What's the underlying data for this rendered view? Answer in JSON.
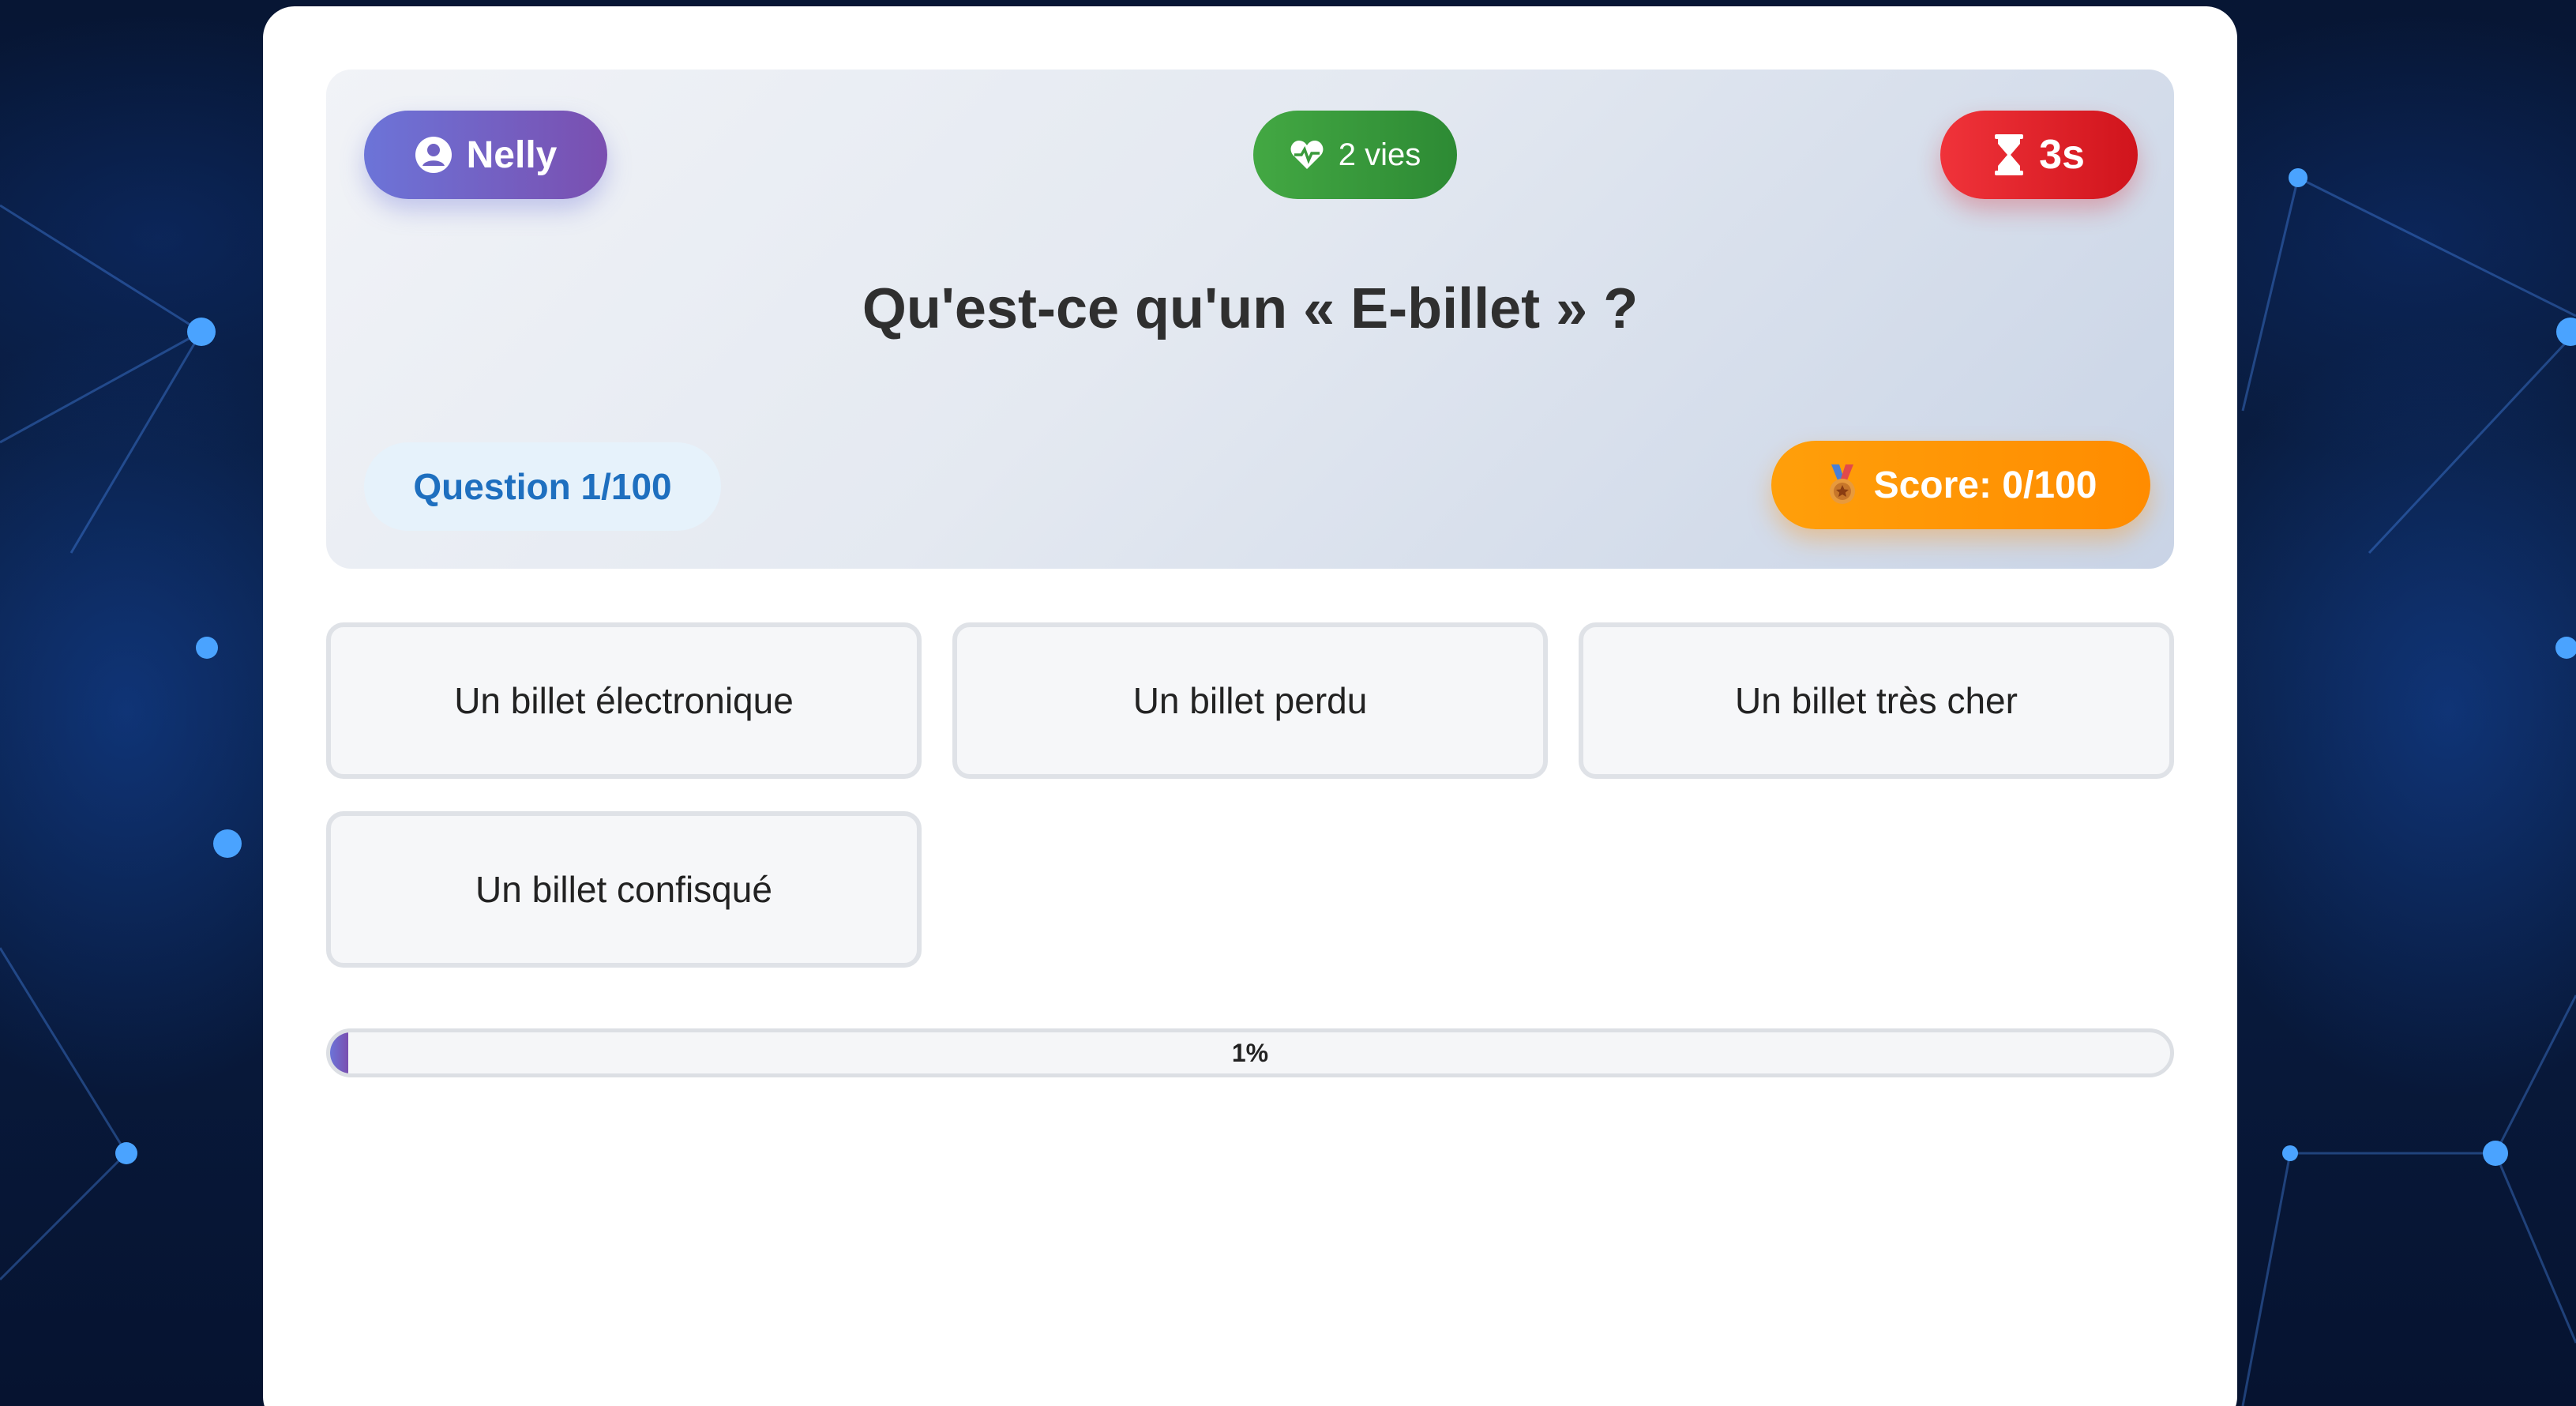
{
  "player": {
    "name": "Nelly",
    "icon": "user-circle-icon"
  },
  "lives": {
    "label": "2 vies",
    "icon": "heart-pulse-icon"
  },
  "timer": {
    "label": "3s",
    "icon": "hourglass-icon"
  },
  "question": {
    "text": "Qu'est-ce qu'un « E-billet » ?",
    "counter": "Question 1/100"
  },
  "score": {
    "label": "Score: 0/100",
    "icon": "medal-icon"
  },
  "answers": [
    {
      "label": "Un billet électronique"
    },
    {
      "label": "Un billet perdu"
    },
    {
      "label": "Un billet très cher"
    },
    {
      "label": "Un billet confisqué"
    }
  ],
  "progress": {
    "value": 0.01,
    "label": "1%"
  },
  "colors": {
    "user_pill": "#6c74d8",
    "lives_pill": "#3a9a3c",
    "timer_pill": "#e8222a",
    "score_pill": "#ff9500",
    "question_counter_text": "#1e6fbf"
  }
}
